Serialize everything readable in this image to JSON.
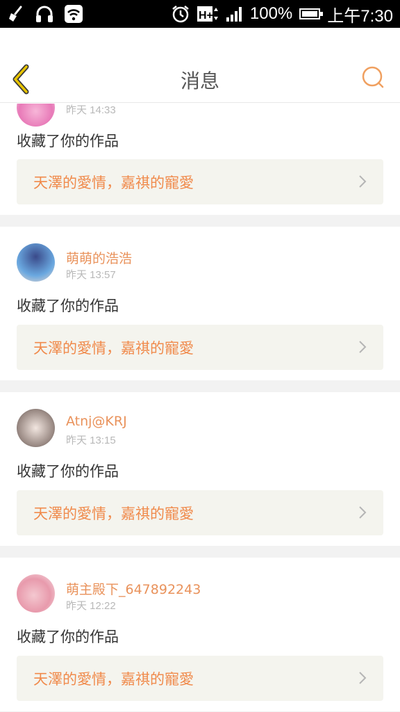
{
  "status_bar": {
    "battery": "100%",
    "network": "H+",
    "time": "上午7:30",
    "battery_level": 1.0,
    "icons": [
      "broom-icon",
      "headphones-icon",
      "wifi-icon",
      "alarm-icon",
      "network-h-plus-icon",
      "signal-icon",
      "battery-icon"
    ]
  },
  "header": {
    "title": "消息",
    "back_icon": "chevron-left-icon",
    "search_icon": "search-icon"
  },
  "messages": [
    {
      "user": "",
      "time": "昨天 14:33",
      "action": "收藏了你的作品",
      "work": "天澤的愛情，嘉祺的寵愛"
    },
    {
      "user": "萌萌的浩浩",
      "time": "昨天 13:57",
      "action": "收藏了你的作品",
      "work": "天澤的愛情，嘉祺的寵愛"
    },
    {
      "user": "Atnj@KRJ",
      "time": "昨天 13:15",
      "action": "收藏了你的作品",
      "work": "天澤的愛情，嘉祺的寵愛"
    },
    {
      "user": "萌主殿下_647892243",
      "time": "昨天 12:22",
      "action": "收藏了你的作品",
      "work": "天澤的愛情，嘉祺的寵愛"
    }
  ],
  "colors": {
    "accent": "#e9925b",
    "work_title": "#f08a4b",
    "work_bg": "#f4f4ee",
    "back_icon": "#e0b800",
    "search_icon": "#f0a060",
    "separator": "#f2f2f2"
  }
}
